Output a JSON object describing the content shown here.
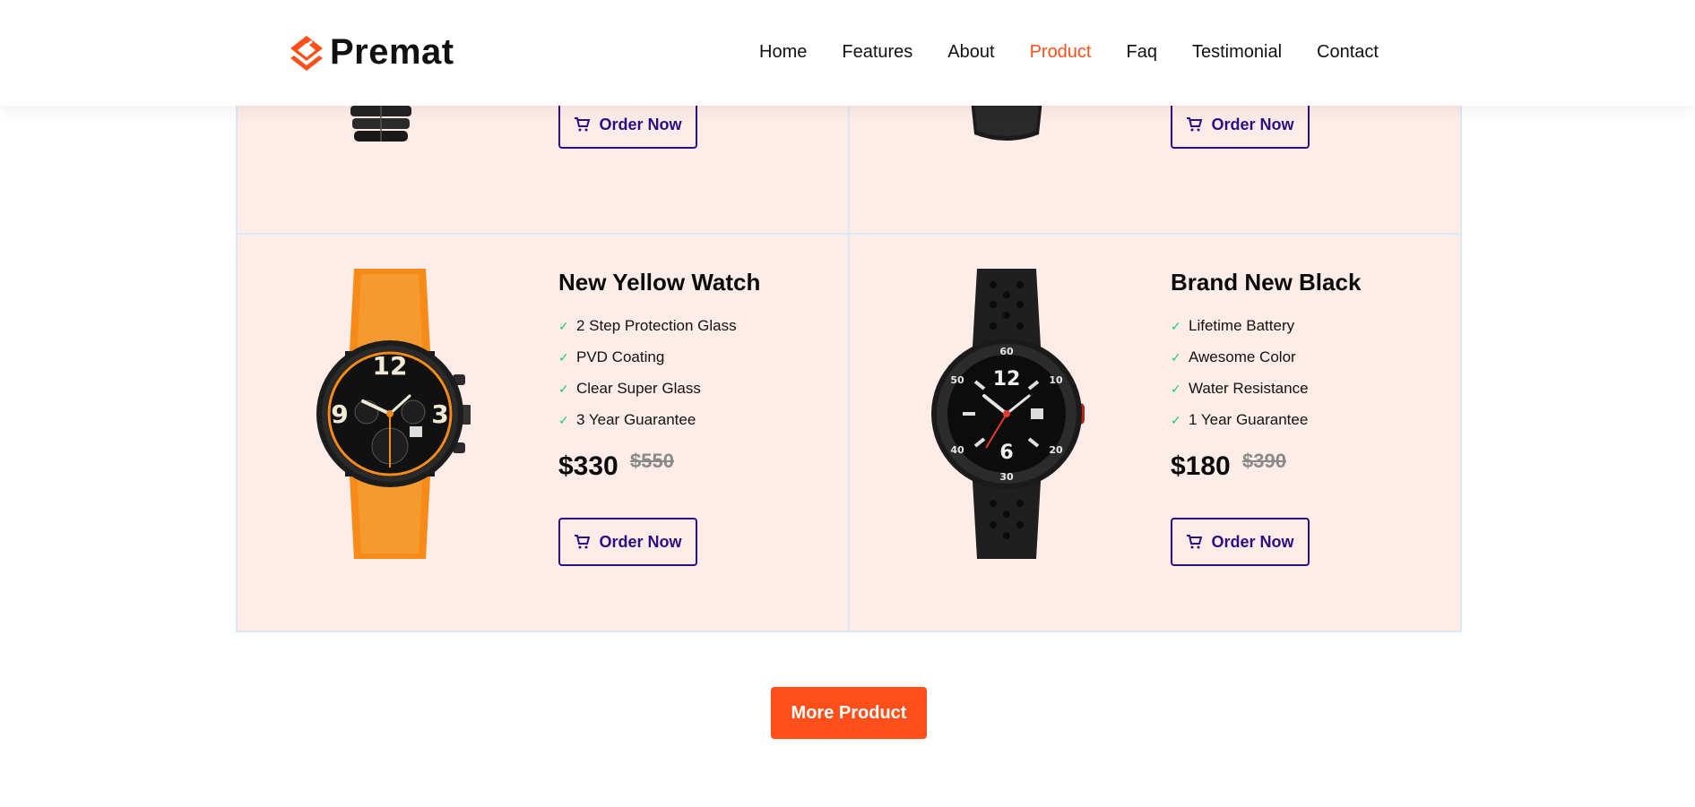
{
  "brand": {
    "name": "Premat",
    "accent": "#ff4f1a",
    "button_color": "#2b0f86",
    "check_color": "#16c784"
  },
  "nav": {
    "items": [
      {
        "label": "Home",
        "active": false
      },
      {
        "label": "Features",
        "active": false
      },
      {
        "label": "About",
        "active": false
      },
      {
        "label": "Product",
        "active": true
      },
      {
        "label": "Faq",
        "active": false
      },
      {
        "label": "Testimonial",
        "active": false
      },
      {
        "label": "Contact",
        "active": false
      }
    ]
  },
  "top_row": {
    "left": {
      "order_label": "Order Now",
      "icon": "black-metal-strap-watch"
    },
    "right": {
      "order_label": "Order Now",
      "icon": "black-leather-strap-watch"
    }
  },
  "products": [
    {
      "title": "New Yellow Watch",
      "features": [
        "2 Step Protection Glass",
        "PVD Coating",
        "Clear Super Glass",
        "3 Year Guarantee"
      ],
      "price": "$330",
      "old_price": "$550",
      "order_label": "Order Now",
      "image": "orange-chronograph-watch"
    },
    {
      "title": "Brand New Black",
      "features": [
        "Lifetime Battery",
        "Awesome Color",
        "Water Resistance",
        "1 Year Guarantee"
      ],
      "price": "$180",
      "old_price": "$390",
      "order_label": "Order Now",
      "image": "black-sport-watch"
    }
  ],
  "more_button": {
    "label": "More Product"
  }
}
